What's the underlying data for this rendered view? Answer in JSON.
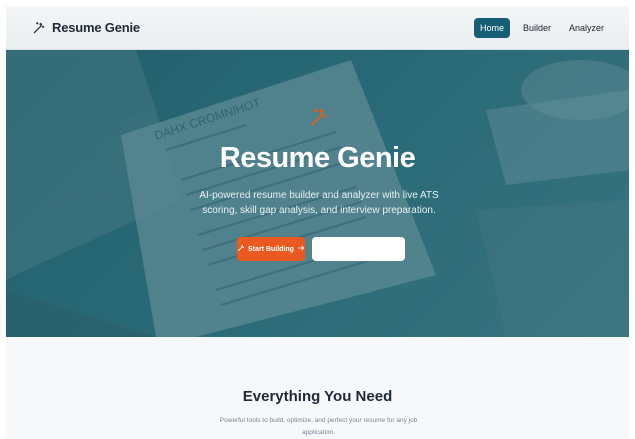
{
  "navbar": {
    "brand": "Resume Genie",
    "brand_icon": "magic-wand-icon",
    "links": [
      {
        "label": "Home",
        "active": true
      },
      {
        "label": "Builder",
        "active": false
      },
      {
        "label": "Analyzer",
        "active": false
      }
    ]
  },
  "hero": {
    "icon": "magic-wand-icon",
    "title": "Resume Genie",
    "subtitle": "AI-powered resume builder and analyzer with live ATS scoring, skill gap analysis, and interview preparation.",
    "primary_button": {
      "label": "Start Building",
      "icon": "magic-wand-icon",
      "trailing_icon": "arrow-right-icon"
    },
    "secondary_button": {
      "label": ""
    },
    "background_name": "DAHX CROMNIHOT",
    "accent_color": "#ea5a1f",
    "brand_color": "#155e75"
  },
  "features": {
    "title": "Everything You Need",
    "subtitle": "Powerful tools to build, optimize, and perfect your resume for any job application."
  }
}
